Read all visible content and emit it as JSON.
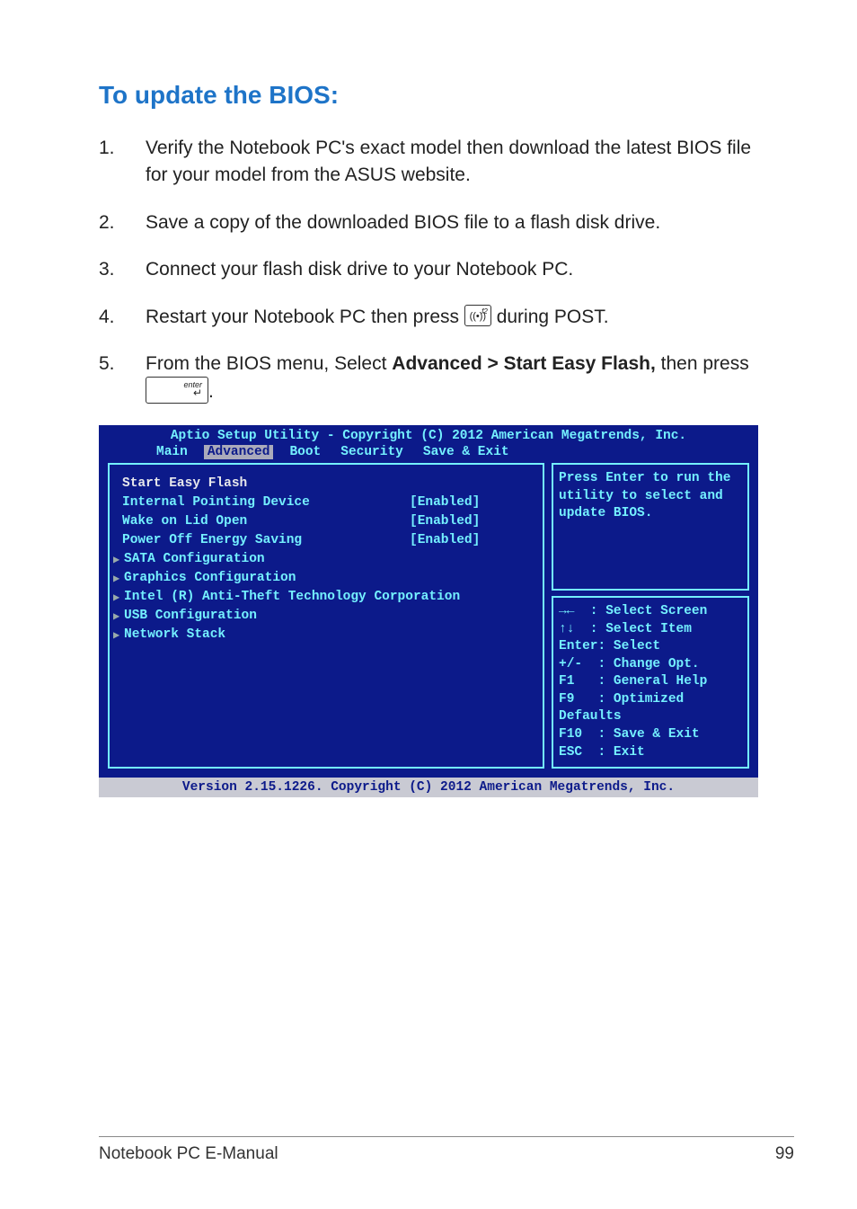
{
  "heading": "To update the BIOS:",
  "steps": [
    {
      "num": "1.",
      "text": "Verify the Notebook PC's exact model then download the latest BIOS file for your model from the ASUS website."
    },
    {
      "num": "2.",
      "text": "Save a copy of the downloaded BIOS file to a flash disk drive."
    },
    {
      "num": "3.",
      "text": "Connect your flash disk drive to your Notebook PC."
    },
    {
      "num": "4.",
      "pre": "Restart your Notebook PC then press ",
      "post": " during POST."
    },
    {
      "num": "5.",
      "pre": "From the BIOS menu, Select ",
      "bold": "Advanced > Start Easy Flash,",
      "mid": " then press ",
      "post": "."
    }
  ],
  "key_f2": {
    "sup": "f2",
    "symbol": "((•))"
  },
  "key_enter": {
    "lbl": "enter",
    "arrow": "↵"
  },
  "bios": {
    "title": "Aptio Setup Utility - Copyright (C) 2012 American Megatrends, Inc.",
    "tabs": [
      "Main",
      "Advanced",
      "Boot",
      "Security",
      "Save & Exit"
    ],
    "active_tab": "Advanced",
    "options": [
      {
        "label": "Start Easy Flash",
        "value": "",
        "selected": true
      },
      {
        "label": "Internal Pointing Device",
        "value": "[Enabled]"
      },
      {
        "label": "Wake on Lid Open",
        "value": "[Enabled]"
      },
      {
        "label": "Power Off Energy Saving",
        "value": "[Enabled]"
      }
    ],
    "submenus": [
      "SATA Configuration",
      "Graphics Configuration",
      "Intel (R) Anti-Theft Technology Corporation",
      "USB Configuration",
      "Network Stack"
    ],
    "help_top": "Press Enter to run the utility to select and update BIOS.",
    "help_bottom": "→←  : Select Screen\n↑↓  : Select Item\nEnter: Select\n+/-  : Change Opt.\nF1   : General Help\nF9   : Optimized Defaults\nF10  : Save & Exit\nESC  : Exit",
    "footer": "Version 2.15.1226. Copyright (C) 2012 American Megatrends, Inc."
  },
  "page_footer": {
    "left": "Notebook PC E-Manual",
    "right": "99"
  }
}
